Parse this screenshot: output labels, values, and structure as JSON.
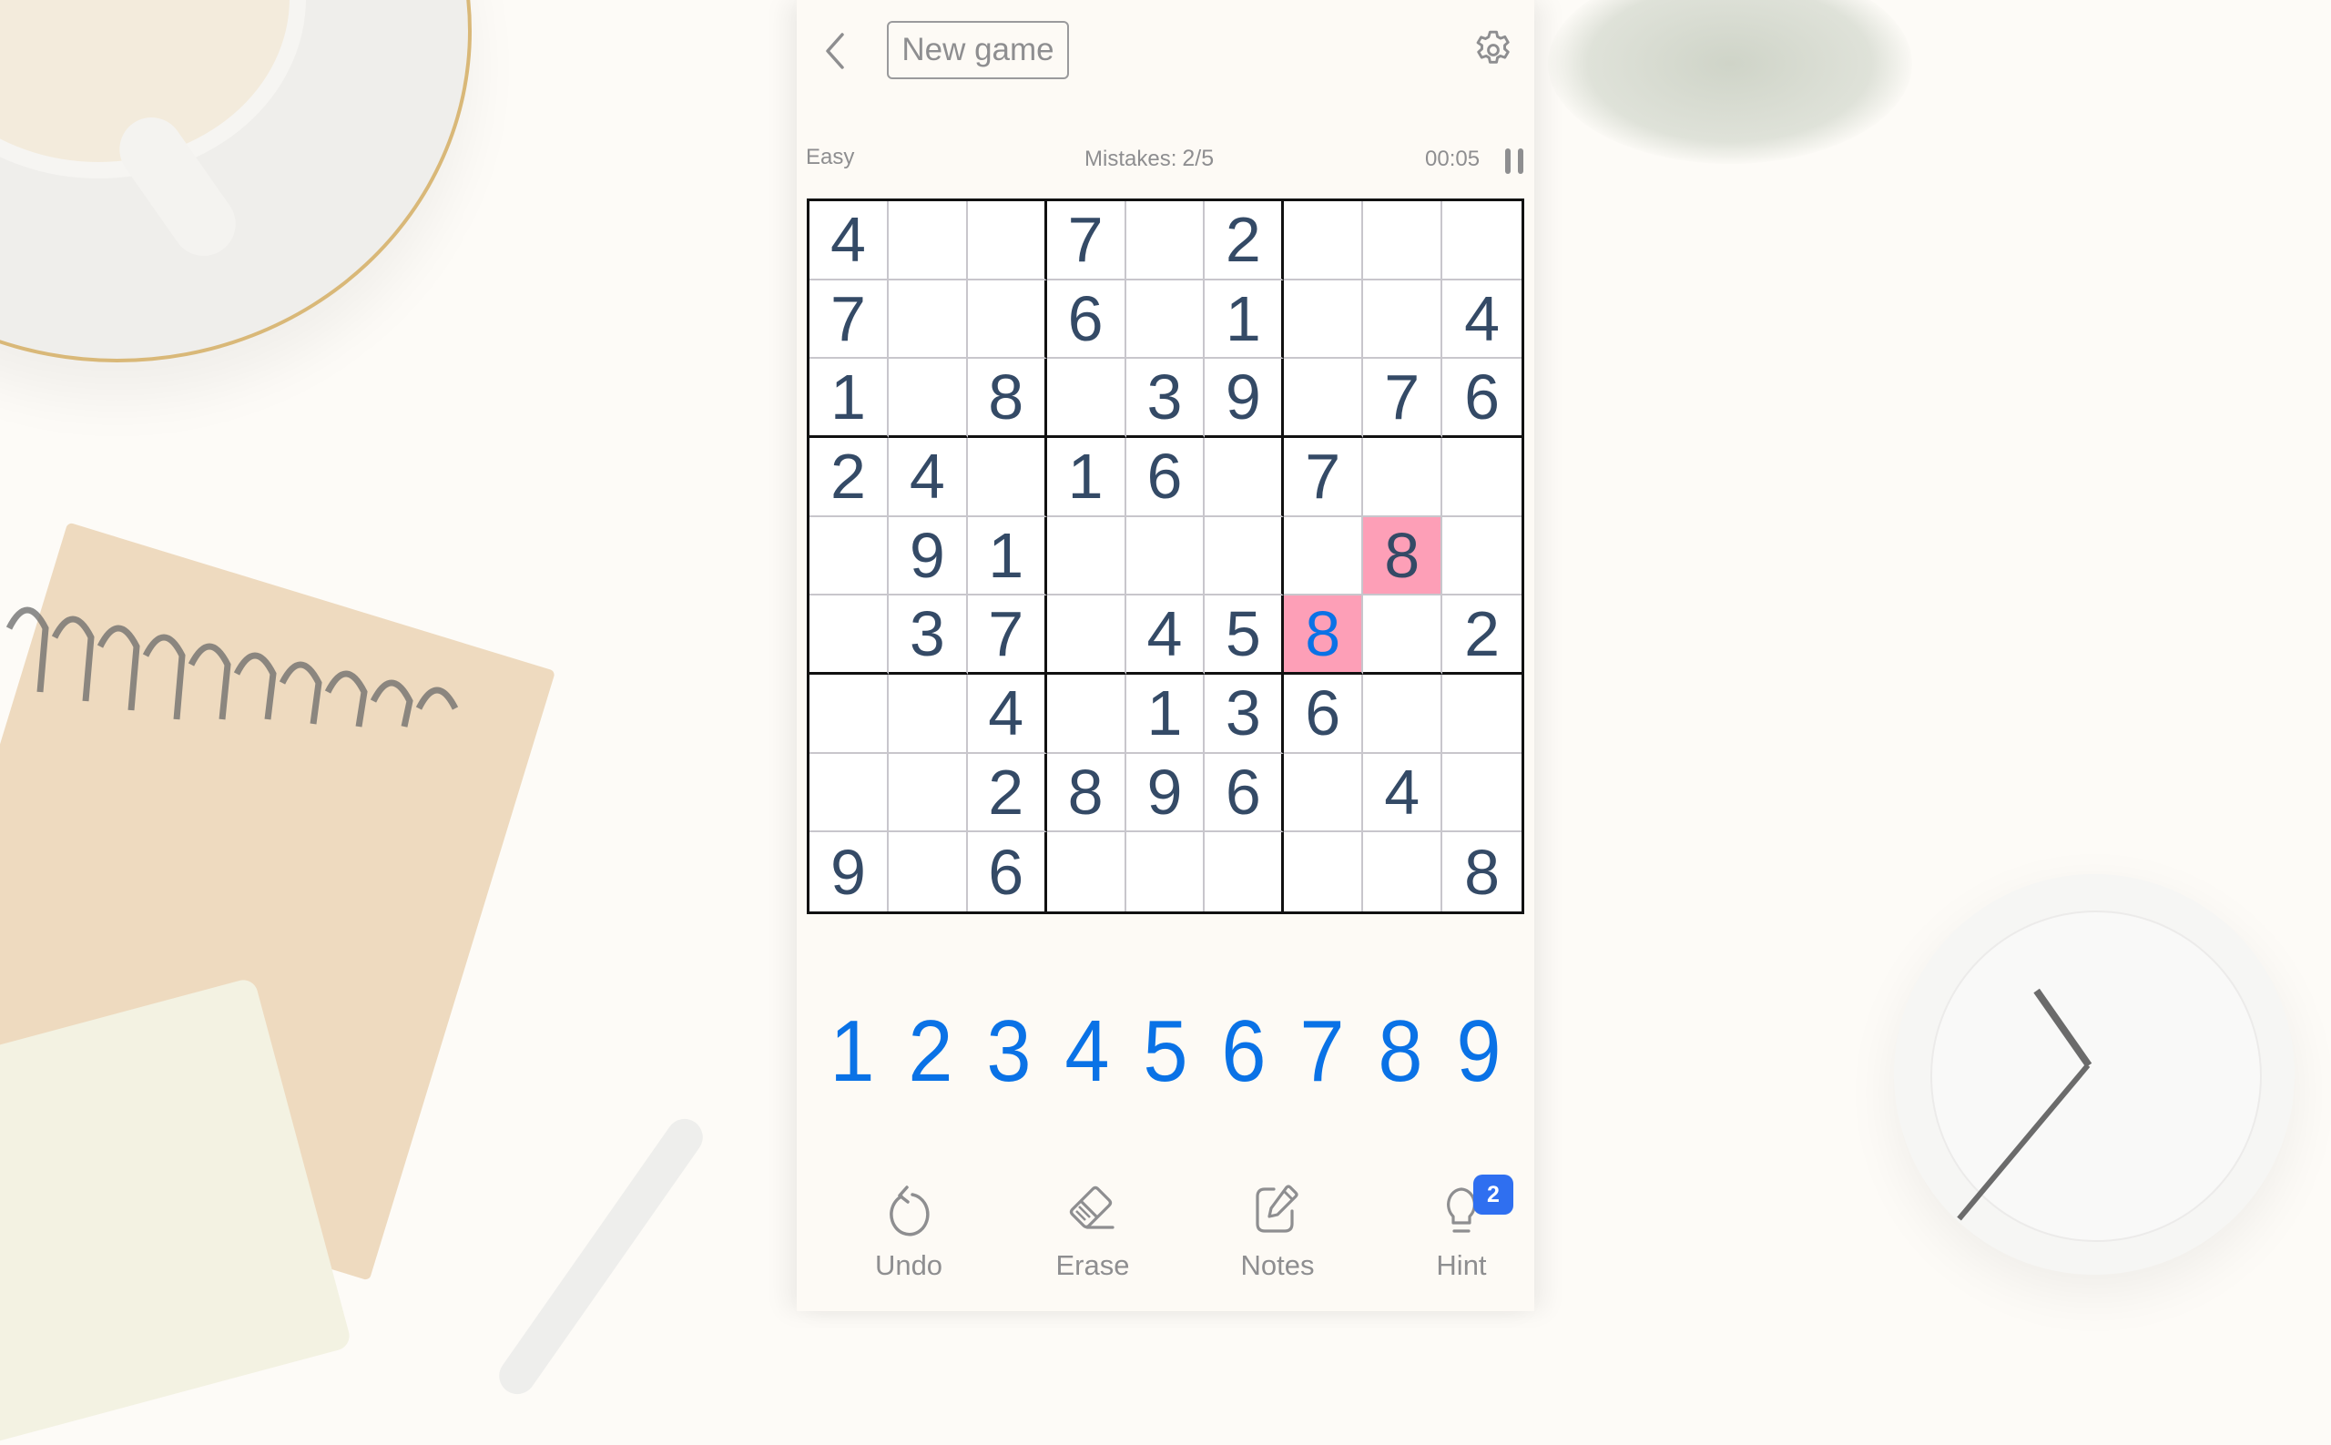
{
  "header": {
    "back_icon": "chevron-left-icon",
    "new_game_label": "New game",
    "settings_icon": "gear-icon"
  },
  "status": {
    "difficulty": "Easy",
    "mistakes_label": "Mistakes:",
    "mistakes_value": "2/5",
    "timer": "00:05",
    "pause_icon": "pause-icon"
  },
  "board": {
    "rows": [
      [
        "4",
        "",
        "",
        "7",
        "",
        "2",
        "",
        "",
        ""
      ],
      [
        "7",
        "",
        "",
        "6",
        "",
        "1",
        "",
        "",
        "4"
      ],
      [
        "1",
        "",
        "8",
        "",
        "3",
        "9",
        "",
        "7",
        "6"
      ],
      [
        "2",
        "4",
        "",
        "1",
        "6",
        "",
        "7",
        "",
        ""
      ],
      [
        "",
        "9",
        "1",
        "",
        "",
        "",
        "",
        "8",
        ""
      ],
      [
        "",
        "3",
        "7",
        "",
        "4",
        "5",
        "8",
        "",
        "2"
      ],
      [
        "",
        "",
        "4",
        "",
        "1",
        "3",
        "6",
        "",
        ""
      ],
      [
        "",
        "",
        "2",
        "8",
        "9",
        "6",
        "",
        "4",
        ""
      ],
      [
        "9",
        "",
        "6",
        "",
        "",
        "",
        "",
        "",
        "8"
      ]
    ],
    "conflict_cells": [
      [
        4,
        7
      ],
      [
        5,
        6
      ]
    ],
    "user_entered_cells": [
      [
        5,
        6
      ]
    ],
    "colors": {
      "given_digit": "#344a66",
      "user_digit": "#0a72e6",
      "conflict_bg": "#fd9fb7"
    }
  },
  "numpad": {
    "keys": [
      "1",
      "2",
      "3",
      "4",
      "5",
      "6",
      "7",
      "8",
      "9"
    ]
  },
  "toolbar": {
    "undo_label": "Undo",
    "erase_label": "Erase",
    "notes_label": "Notes",
    "hint_label": "Hint",
    "hint_count": "2"
  }
}
